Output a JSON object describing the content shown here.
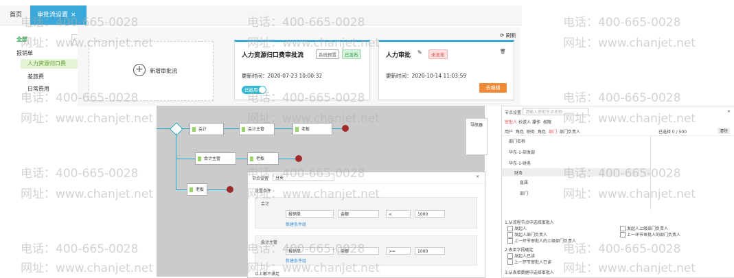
{
  "tabs": {
    "home": "首页",
    "active": "审批流设置",
    "close": "×"
  },
  "tree": {
    "root": "全部",
    "group": "报销单",
    "items": [
      "人力资源归口费",
      "差旅费",
      "日常费用"
    ]
  },
  "collapse": "<",
  "add_card": {
    "plus": "+",
    "label": "新增审批流"
  },
  "cards": [
    {
      "title": "人力资源归口费审批流",
      "badge1": "系统预置",
      "badge2": "已发布",
      "time": "更新时间：2020-07-23 10:00:32",
      "toggle": "已启用"
    },
    {
      "title": "人力审批",
      "edit_icon": "✎",
      "badge": "未发布",
      "time": "更新时间：2020-10-14 11:03:59",
      "trash": "🗑",
      "button": "去编辑"
    }
  ],
  "refresh": "刷新",
  "flow": {
    "minimap": "导航器",
    "nodes": [
      "会计",
      "会计主管",
      "老板",
      "会计主管",
      "老板",
      "老板"
    ],
    "condition_panel": {
      "title": "节点设置",
      "input": "分支",
      "label1": "设置条件",
      "group1": {
        "name": "会计",
        "f1": "报销单",
        "f2": "金额",
        "op": "<",
        "val": "1000",
        "add": "新建条件组"
      },
      "group2": {
        "name": "会计主管",
        "f1": "报销单",
        "f2": "金额",
        "op": ">=",
        "val": "1000",
        "add": "新建条件组"
      },
      "label2": "以上都不满足"
    }
  },
  "right_panel": {
    "title": "节点设置",
    "search_placeholder": "请输入审批节点名称",
    "tabs": [
      "审批人",
      "抄送人",
      "操作",
      "权限"
    ],
    "subtabs": [
      "用户",
      "角色",
      "职务",
      "角色",
      "部门",
      "部门负责人"
    ],
    "left_header": "部门名称",
    "right_header": "已选择 0 / 500",
    "clear": "清除",
    "depts": [
      "华东-1-研发部",
      "华东-1-财务",
      "财务",
      "直属",
      "部门"
    ],
    "sec1": "1.从流程节点中选择审批人",
    "opts1": [
      "发起人",
      "发起人部门负责人",
      "上一环节审批人的上级部门负责人"
    ],
    "opts1b": [
      "发起人上级部门负责人",
      "上一环节审批人的部门负责人"
    ],
    "sec2": "2.表单字段确定",
    "opts2": [
      "发起人已读",
      "上一环节审批人已读"
    ],
    "sec3": "3.从表单数据中选择审批人"
  },
  "watermark": {
    "tel": "电话：400-665-0028",
    "web": "网址：www.chanjet.net"
  },
  "colors": {
    "accent": "#3aa8d8",
    "green": "#2f9e4a",
    "orange": "#f08a37",
    "red": "#a02b2b"
  }
}
